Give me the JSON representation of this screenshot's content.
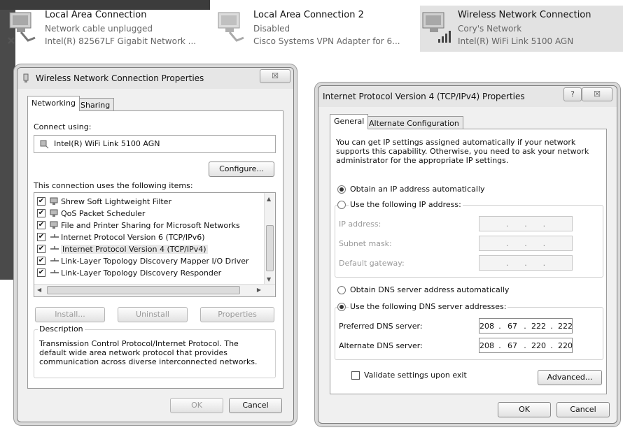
{
  "connections": [
    {
      "name": "Local Area Connection",
      "status": "Network cable unplugged",
      "adapter": "Intel(R) 82567LF Gigabit Network ..."
    },
    {
      "name": "Local Area Connection 2",
      "status": "Disabled",
      "adapter": "Cisco Systems VPN Adapter for 6..."
    },
    {
      "name": "Wireless Network Connection",
      "status": "Cory's Network",
      "adapter": "Intel(R) WiFi Link 5100 AGN"
    }
  ],
  "wireless_props": {
    "title": "Wireless Network Connection Properties",
    "close": "☒",
    "tabs": [
      "Networking",
      "Sharing"
    ],
    "connect_using_label": "Connect using:",
    "adapter": "Intel(R) WiFi Link 5100 AGN",
    "configure_label": "Configure...",
    "items_label": "This connection uses the following items:",
    "items": [
      {
        "label": "Shrew Soft Lightweight Filter",
        "checked": true,
        "icon": "network-service-icon"
      },
      {
        "label": "QoS Packet Scheduler",
        "checked": true,
        "icon": "network-service-icon"
      },
      {
        "label": "File and Printer Sharing for Microsoft Networks",
        "checked": true,
        "icon": "network-service-icon"
      },
      {
        "label": "Internet Protocol Version 6 (TCP/IPv6)",
        "checked": true,
        "icon": "protocol-icon"
      },
      {
        "label": "Internet Protocol Version 4 (TCP/IPv4)",
        "checked": true,
        "icon": "protocol-icon"
      },
      {
        "label": "Link-Layer Topology Discovery Mapper I/O Driver",
        "checked": true,
        "icon": "protocol-icon"
      },
      {
        "label": "Link-Layer Topology Discovery Responder",
        "checked": true,
        "icon": "protocol-icon"
      }
    ],
    "install_label": "Install...",
    "uninstall_label": "Uninstall",
    "properties_label": "Properties",
    "description_title": "Description",
    "description_text": "Transmission Control Protocol/Internet Protocol. The default wide area network protocol that provides communication across diverse interconnected networks.",
    "ok_label": "OK",
    "cancel_label": "Cancel"
  },
  "ipv4_props": {
    "title": "Internet Protocol Version 4 (TCP/IPv4) Properties",
    "help": "?",
    "close": "☒",
    "tabs": [
      "General",
      "Alternate Configuration"
    ],
    "intro": "You can get IP settings assigned automatically if your network supports this capability. Otherwise, you need to ask your network administrator for the appropriate IP settings.",
    "obtain_ip_auto": "Obtain an IP address automatically",
    "use_following_ip": "Use the following IP address:",
    "ip_address_label": "IP address:",
    "subnet_mask_label": "Subnet mask:",
    "default_gateway_label": "Default gateway:",
    "obtain_dns_auto": "Obtain DNS server address automatically",
    "use_following_dns": "Use the following DNS server addresses:",
    "preferred_dns_label": "Preferred DNS server:",
    "preferred_dns": [
      "208",
      "67",
      "222",
      "222"
    ],
    "alternate_dns_label": "Alternate DNS server:",
    "alternate_dns": [
      "208",
      "67",
      "220",
      "220"
    ],
    "validate_label": "Validate settings upon exit",
    "advanced_label": "Advanced...",
    "ok_label": "OK",
    "cancel_label": "Cancel",
    "empty_octet": "."
  }
}
